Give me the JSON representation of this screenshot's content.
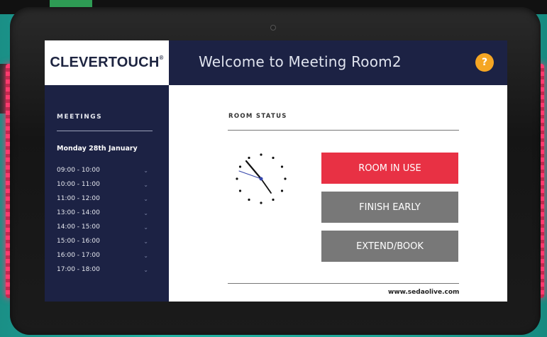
{
  "brand": {
    "logo": "CLEVERTOUCH",
    "trademark": "®"
  },
  "header": {
    "title": "Welcome to Meeting Room2",
    "help": "?"
  },
  "sidebar": {
    "heading": "MEETINGS",
    "date": "Monday 28th January",
    "slots": [
      "09:00 - 10:00",
      "10:00 - 11:00",
      "11:00 - 12:00",
      "13:00 - 14:00",
      "14:00 - 15:00",
      "15:00 - 16:00",
      "16:00 - 17:00",
      "17:00 - 18:00"
    ]
  },
  "main": {
    "status_heading": "ROOM STATUS",
    "buttons": {
      "room_in_use": "ROOM IN USE",
      "finish_early": "FINISH EARLY",
      "extend_book": "EXTEND/BOOK"
    },
    "website": "www.sedaolive.com"
  },
  "colors": {
    "navy": "#1c2244",
    "in_use_red": "#e83144",
    "button_grey": "#787878",
    "help_orange": "#f5a623",
    "led_glow": "#ff3a6e"
  },
  "icons": {
    "help": "question-circle-icon",
    "chevron": "chevron-down-icon",
    "clock": "analog-clock-icon",
    "camera": "camera-icon"
  }
}
